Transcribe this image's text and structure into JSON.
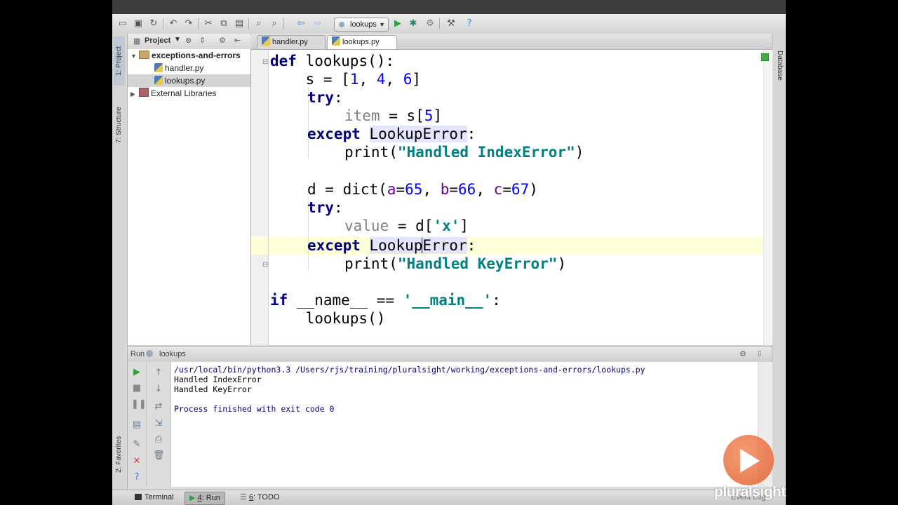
{
  "toolbar": {
    "run_config": "lookups"
  },
  "left_stripe": {
    "project_tab": "1: Project",
    "structure_tab": "7: Structure",
    "favorites_tab": "2: Favorites"
  },
  "right_stripe": {
    "database_tab": "Database"
  },
  "project_panel": {
    "header": "Project",
    "tree": [
      {
        "label": "exceptions-and-errors"
      },
      {
        "label": "handler.py"
      },
      {
        "label": "lookups.py"
      },
      {
        "label": "External Libraries"
      }
    ]
  },
  "editor": {
    "tabs": [
      {
        "label": "handler.py"
      },
      {
        "label": "lookups.py"
      }
    ],
    "code": {
      "l1_kw": "def",
      "l1_rest": " lookups():",
      "l2_a": "    s = [",
      "l2_n1": "1",
      "l2_sep1": ", ",
      "l2_n2": "4",
      "l2_sep2": ", ",
      "l2_n3": "6",
      "l2_end": "]",
      "l3_kw": "try",
      "l3_end": ":",
      "l4_a": "item",
      "l4_b": " = s[",
      "l4_n": "5",
      "l4_c": "]",
      "l5_kw": "except",
      "l5_err": "LookupError",
      "l5_end": ":",
      "l6_a": "print(",
      "l6_str": "\"Handled IndexError\"",
      "l6_end": ")",
      "l8_a": "d = dict(",
      "l8_p1": "a",
      "l8_e1": "=",
      "l8_v1": "65",
      "l8_s1": ", ",
      "l8_p2": "b",
      "l8_e2": "=",
      "l8_v2": "66",
      "l8_s2": ", ",
      "l8_p3": "c",
      "l8_e3": "=",
      "l8_v3": "67",
      "l8_end": ")",
      "l9_kw": "try",
      "l9_end": ":",
      "l10_a": "value",
      "l10_b": " = d[",
      "l10_str": "'x'",
      "l10_c": "]",
      "l11_kw": "except",
      "l11_err1": "Lookup",
      "l11_err2": "Error",
      "l11_end": ":",
      "l12_a": "print(",
      "l12_str": "\"Handled KeyError\"",
      "l12_end": ")",
      "l14_kw": "if",
      "l14_a": " __name__ == ",
      "l14_str": "'__main__'",
      "l14_end": ":",
      "l15_a": "    lookups()"
    }
  },
  "run_panel": {
    "title": "Run",
    "config": "lookups",
    "console": [
      "/usr/local/bin/python3.3 /Users/rjs/training/pluralsight/working/exceptions-and-errors/lookups.py",
      "Handled IndexError",
      "Handled KeyError",
      "",
      "Process finished with exit code 0"
    ]
  },
  "bottom_bar": {
    "terminal": "Terminal",
    "run_prefix": "4",
    "run": ": Run",
    "todo_prefix": "6",
    "todo": ": TODO",
    "event_log": "Event Log"
  },
  "watermark": {
    "text": "pluralsight"
  },
  "colors": {
    "keyword": "#000080",
    "number": "#0000ff",
    "string": "#008080",
    "param": "#660099",
    "current_line": "#ffffd7",
    "highlight": "#e4e4ff"
  }
}
